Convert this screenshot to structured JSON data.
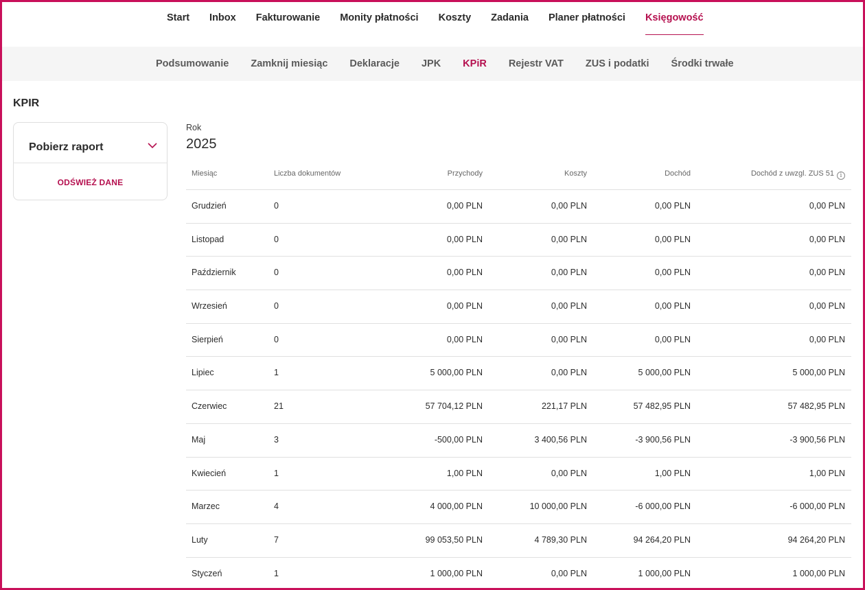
{
  "topnav": {
    "items": [
      {
        "label": "Start"
      },
      {
        "label": "Inbox"
      },
      {
        "label": "Fakturowanie"
      },
      {
        "label": "Monity płatności"
      },
      {
        "label": "Koszty"
      },
      {
        "label": "Zadania"
      },
      {
        "label": "Planer płatności"
      },
      {
        "label": "Księgowość",
        "active": true
      }
    ]
  },
  "subnav": {
    "items": [
      {
        "label": "Podsumowanie"
      },
      {
        "label": "Zamknij miesiąc"
      },
      {
        "label": "Deklaracje"
      },
      {
        "label": "JPK"
      },
      {
        "label": "KPiR",
        "active": true
      },
      {
        "label": "Rejestr VAT"
      },
      {
        "label": "ZUS i podatki"
      },
      {
        "label": "Środki trwałe"
      }
    ]
  },
  "page": {
    "title": "KPIR"
  },
  "card": {
    "report_label": "Pobierz raport",
    "refresh_label": "ODŚWIEŻ DANE",
    "icon": "chevron-down-icon"
  },
  "year": {
    "label": "Rok",
    "value": "2025"
  },
  "table": {
    "headers": [
      "Miesiąc",
      "Liczba dokumentów",
      "Przychody",
      "Koszty",
      "Dochód",
      "Dochód z uwzgl. ZUS 51"
    ],
    "info_glyph": "i",
    "rows": [
      [
        "Grudzień",
        "0",
        "0,00 PLN",
        "0,00 PLN",
        "0,00 PLN",
        "0,00 PLN"
      ],
      [
        "Listopad",
        "0",
        "0,00 PLN",
        "0,00 PLN",
        "0,00 PLN",
        "0,00 PLN"
      ],
      [
        "Październik",
        "0",
        "0,00 PLN",
        "0,00 PLN",
        "0,00 PLN",
        "0,00 PLN"
      ],
      [
        "Wrzesień",
        "0",
        "0,00 PLN",
        "0,00 PLN",
        "0,00 PLN",
        "0,00 PLN"
      ],
      [
        "Sierpień",
        "0",
        "0,00 PLN",
        "0,00 PLN",
        "0,00 PLN",
        "0,00 PLN"
      ],
      [
        "Lipiec",
        "1",
        "5 000,00 PLN",
        "0,00 PLN",
        "5 000,00 PLN",
        "5 000,00 PLN"
      ],
      [
        "Czerwiec",
        "21",
        "57 704,12 PLN",
        "221,17 PLN",
        "57 482,95 PLN",
        "57 482,95 PLN"
      ],
      [
        "Maj",
        "3",
        "-500,00 PLN",
        "3 400,56 PLN",
        "-3 900,56 PLN",
        "-3 900,56 PLN"
      ],
      [
        "Kwiecień",
        "1",
        "1,00 PLN",
        "0,00 PLN",
        "1,00 PLN",
        "1,00 PLN"
      ],
      [
        "Marzec",
        "4",
        "4 000,00 PLN",
        "10 000,00 PLN",
        "-6 000,00 PLN",
        "-6 000,00 PLN"
      ],
      [
        "Luty",
        "7",
        "99 053,50 PLN",
        "4 789,30 PLN",
        "94 264,20 PLN",
        "94 264,20 PLN"
      ],
      [
        "Styczeń",
        "1",
        "1 000,00 PLN",
        "0,00 PLN",
        "1 000,00 PLN",
        "1 000,00 PLN"
      ]
    ]
  },
  "colors": {
    "accent": "#b5104f",
    "frame": "#c8105a",
    "subnav_bg": "#f5f5f5"
  }
}
